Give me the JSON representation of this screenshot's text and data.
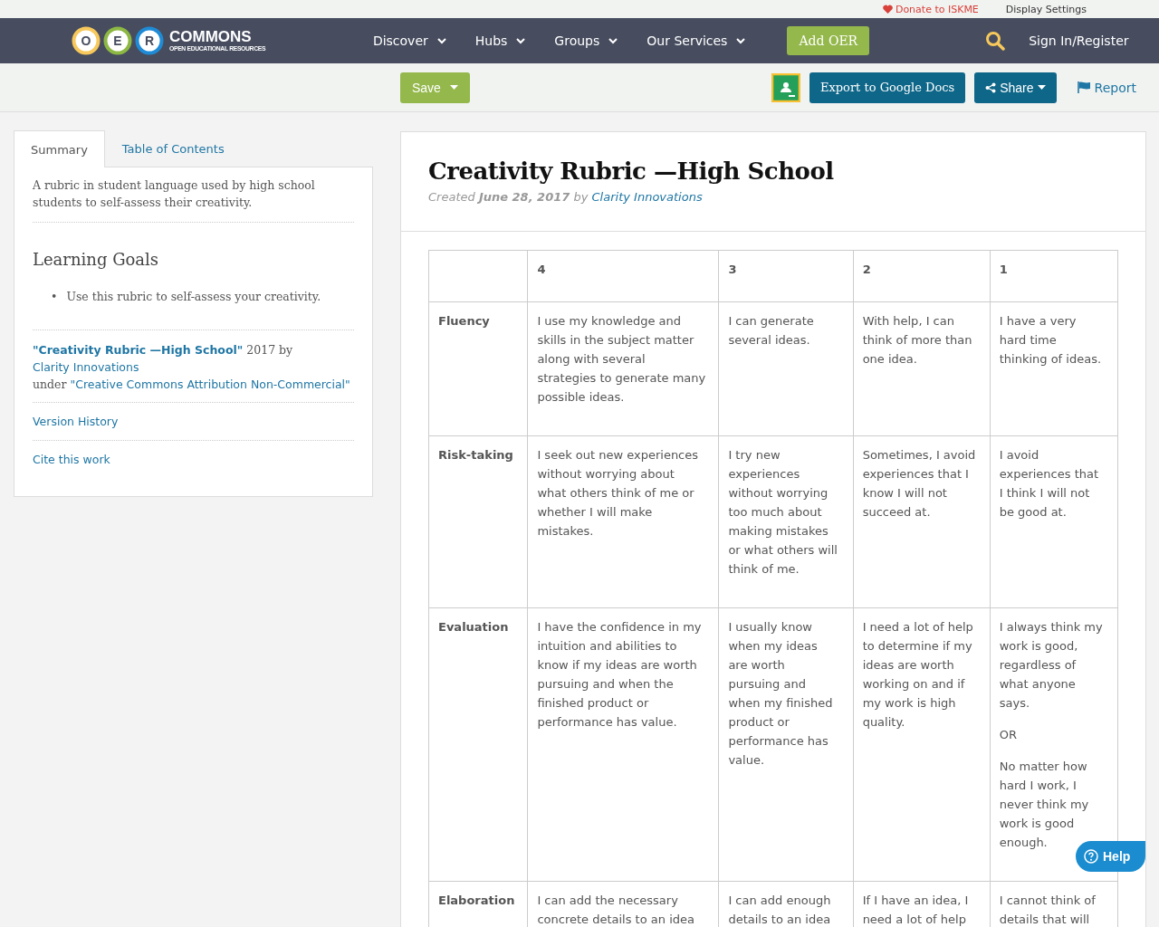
{
  "top_bar": {
    "donate": "Donate to ISKME",
    "display_settings": "Display Settings"
  },
  "nav": {
    "logo": {
      "letters": [
        "O",
        "E",
        "R"
      ],
      "name": "COMMONS",
      "tagline": "OPEN EDUCATIONAL RESOURCES"
    },
    "menus": [
      "Discover",
      "Hubs",
      "Groups",
      "Our Services"
    ],
    "add_button": "Add OER",
    "sign_in": "Sign In/Register"
  },
  "toolbar": {
    "save": "Save",
    "export": "Export to Google Docs",
    "share": "Share",
    "report": "Report"
  },
  "sidebar": {
    "tabs": [
      {
        "label": "Summary",
        "selected": true
      },
      {
        "label": "Table of Contents",
        "selected": false
      }
    ],
    "summary": "A rubric in student language used by high school students to self-assess their creativity.",
    "goals_title": "Learning Goals",
    "goals": [
      {
        "marker": "•",
        "text": "Use this rubric to self-assess your creativity."
      }
    ],
    "attribution": {
      "title": "\"Creativity Rubric —High School\"",
      "year": "2017 by",
      "author": "Clarity Innovations",
      "under": "under",
      "license": "\"Creative Commons Attribution Non-Commercial\""
    },
    "links": [
      "Version History",
      "Cite this work"
    ]
  },
  "resource": {
    "title": "Creativity Rubric —High School",
    "created": "Created",
    "date": "June 28, 2017",
    "by": "by",
    "author": "Clarity Innovations",
    "table": {
      "columns": [
        "",
        "4",
        "3",
        "2",
        "1"
      ],
      "rows": [
        {
          "cells": [
            [
              "Fluency"
            ],
            [
              "I use my knowledge and skills in the subject matter along with several strategies to generate many possible ideas."
            ],
            [
              "I can generate several ideas."
            ],
            [
              "With help, I can think of more than one idea."
            ],
            [
              "I have a very hard time thinking of ideas."
            ]
          ]
        },
        {
          "cells": [
            [
              "Risk-taking"
            ],
            [
              "I seek out new experiences without worrying about what others think of me or whether I will make mistakes."
            ],
            [
              "I try new experiences without worrying too much about making mistakes or what others will think of me."
            ],
            [
              "Sometimes, I avoid experiences that I know I will not succeed at."
            ],
            [
              "I avoid experiences that I think I will not be good at."
            ]
          ]
        },
        {
          "cells": [
            [
              "Evaluation"
            ],
            [
              "I have the confidence in my intuition and abilities to know if my ideas are worth pursuing and when the finished product or performance has value."
            ],
            [
              "I usually know when my ideas are worth pursuing and when my finished product or performance has value."
            ],
            [
              "I need a lot of help to determine if my ideas are worth working on and if my work is high quality."
            ],
            [
              "I always think my work is good, regardless of what anyone says.",
              "OR",
              "No matter how hard I work, I never think my work is good enough."
            ]
          ]
        },
        {
          "cells": [
            [
              "Elaboration"
            ],
            [
              "I can add the necessary concrete details to an idea"
            ],
            [
              "I can add enough details to an idea"
            ],
            [
              "If I have an idea, I need a lot of help"
            ],
            [
              "I cannot think of details that will"
            ]
          ]
        }
      ]
    }
  },
  "help_button": "Help"
}
